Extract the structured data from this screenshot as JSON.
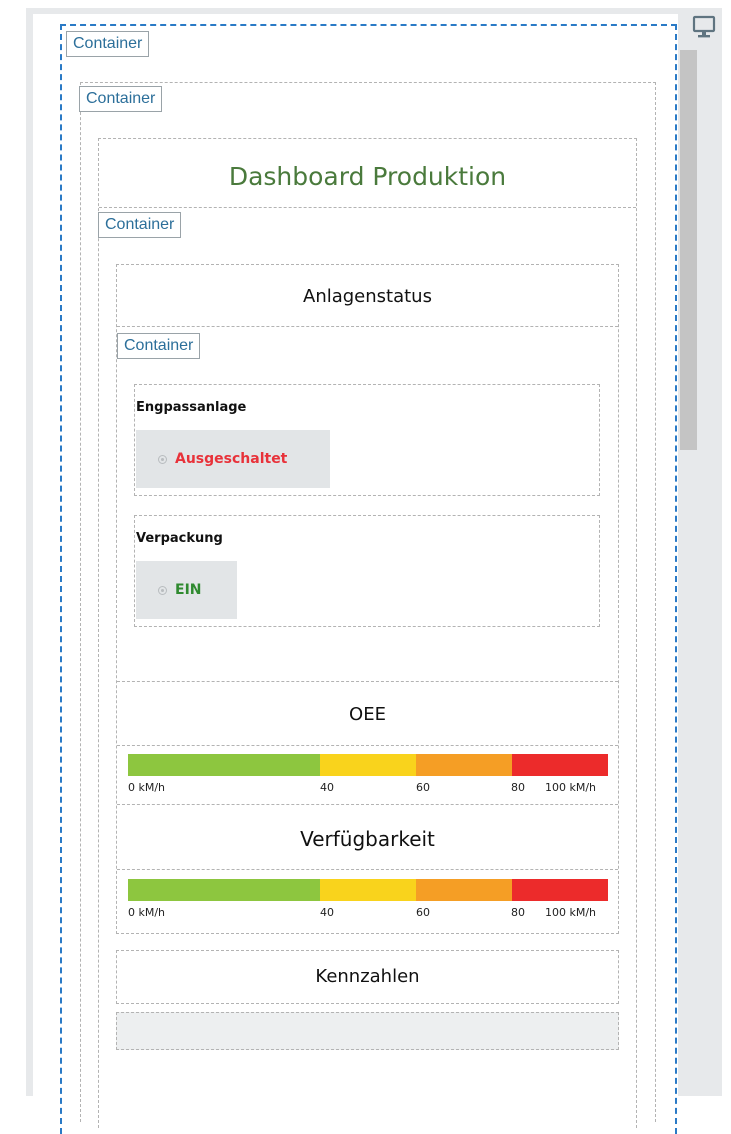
{
  "page": {
    "container_label": "Container",
    "title": "Dashboard Produktion"
  },
  "icons": {
    "device": "monitor-icon"
  },
  "anlagenstatus": {
    "heading": "Anlagenstatus",
    "items": [
      {
        "name": "Engpassanlage",
        "status": "Ausgeschaltet",
        "status_color": "#e8323a"
      },
      {
        "name": "Verpackung",
        "status": "EIN",
        "status_color": "#2f8a2f"
      }
    ]
  },
  "gauges": {
    "oee": {
      "heading": "OEE",
      "tick_labels": [
        "0 kM/h",
        "40",
        "60",
        "80",
        "100 kM/h"
      ]
    },
    "verfuegbarkeit": {
      "heading": "Verfügbarkeit",
      "tick_labels": [
        "0 kM/h",
        "40",
        "60",
        "80",
        "100 kM/h"
      ]
    },
    "bands": [
      {
        "from": 0,
        "to": 40,
        "color": "#8dc63f"
      },
      {
        "from": 40,
        "to": 60,
        "color": "#f9d31c"
      },
      {
        "from": 60,
        "to": 80,
        "color": "#f59e25"
      },
      {
        "from": 80,
        "to": 100,
        "color": "#ec2b2b"
      }
    ]
  },
  "kennzahlen": {
    "heading": "Kennzahlen"
  }
}
